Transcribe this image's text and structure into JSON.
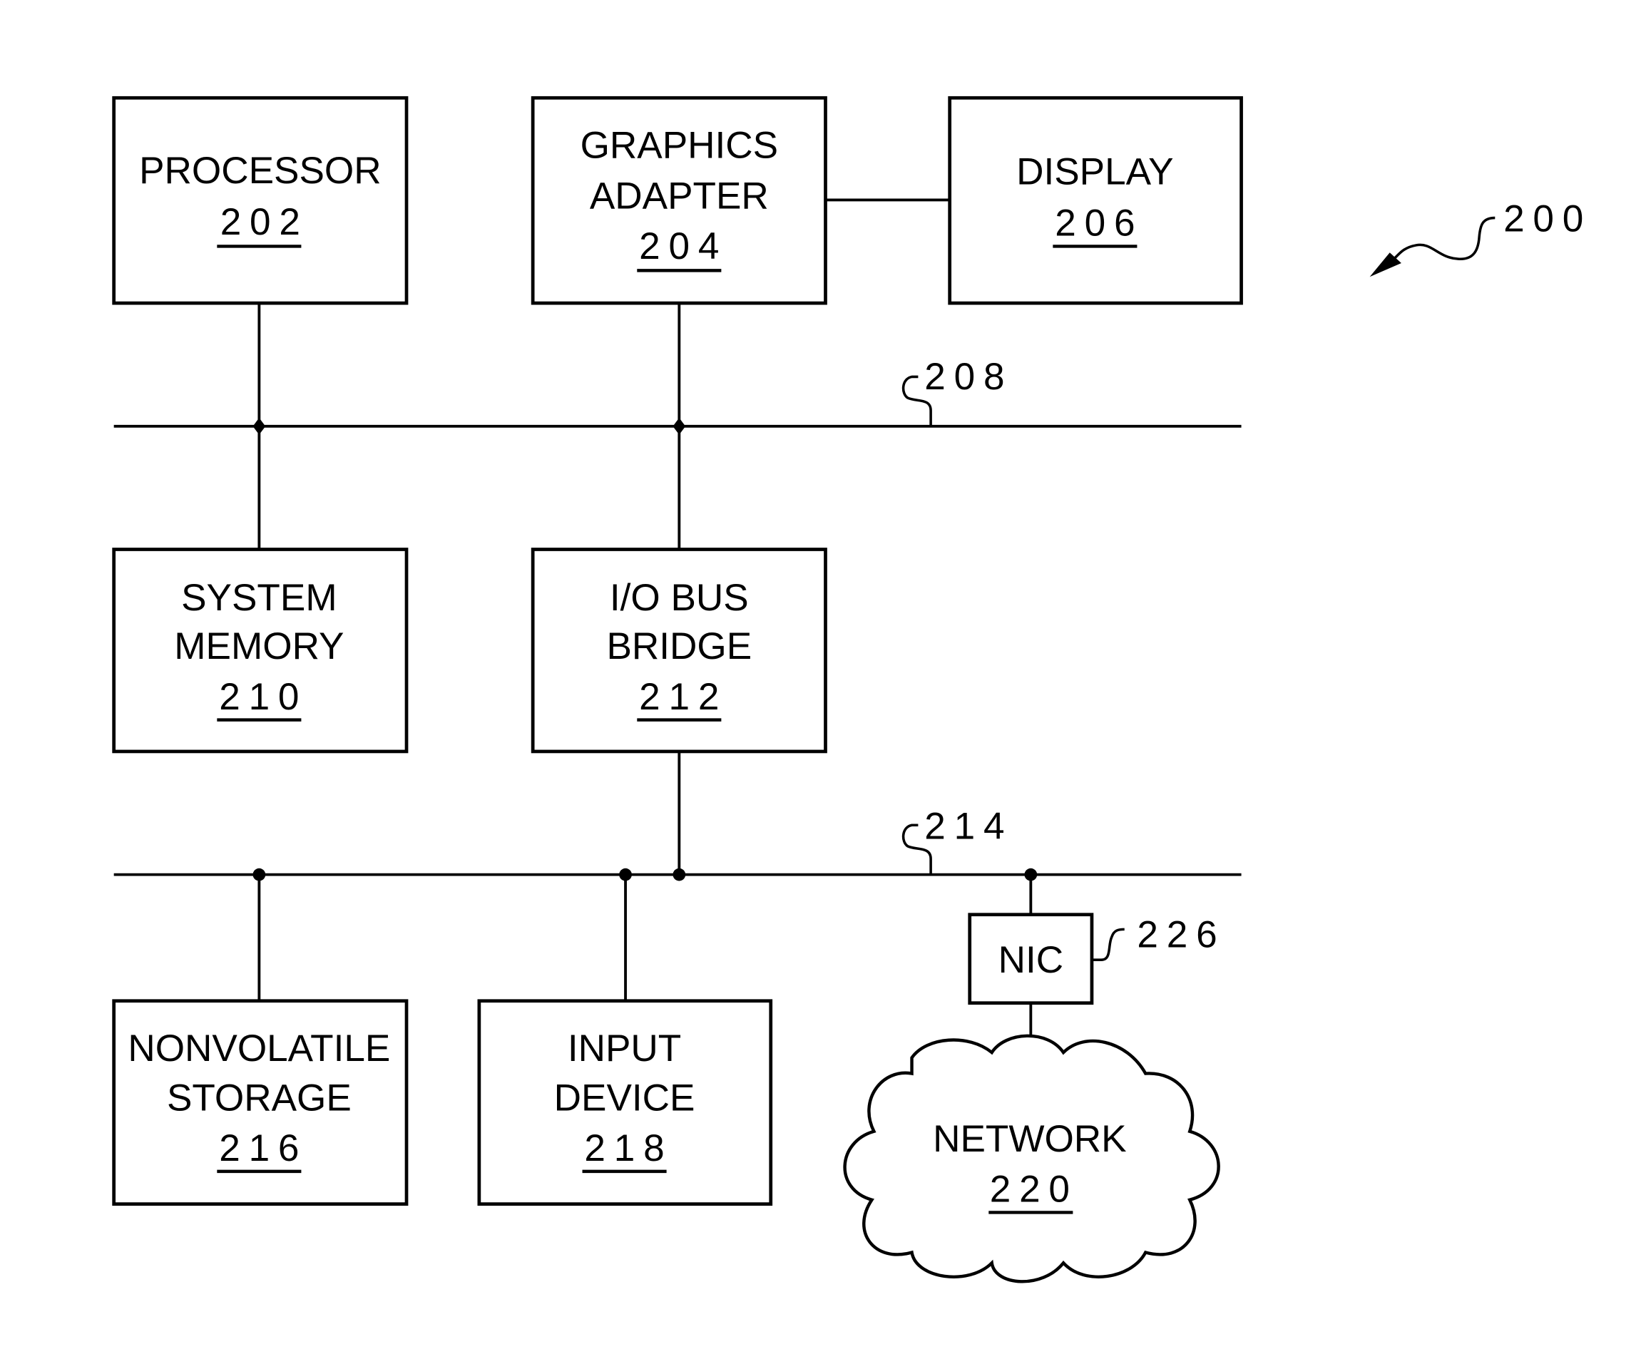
{
  "figure_ref": "200",
  "components": {
    "processor": {
      "lines": [
        "PROCESSOR"
      ],
      "ref": "202"
    },
    "graphics_adapter": {
      "lines": [
        "GRAPHICS",
        "ADAPTER"
      ],
      "ref": "204"
    },
    "display": {
      "lines": [
        "DISPLAY"
      ],
      "ref": "206"
    },
    "system_memory": {
      "lines": [
        "SYSTEM",
        "MEMORY"
      ],
      "ref": "210"
    },
    "io_bus_bridge": {
      "lines": [
        "I/O BUS",
        "BRIDGE"
      ],
      "ref": "212"
    },
    "nonvolatile_storage": {
      "lines": [
        "NONVOLATILE",
        "STORAGE"
      ],
      "ref": "216"
    },
    "input_device": {
      "lines": [
        "INPUT",
        "DEVICE"
      ],
      "ref": "218"
    },
    "nic": {
      "lines": [
        "NIC"
      ],
      "ref": "226"
    },
    "network": {
      "lines": [
        "NETWORK"
      ],
      "ref": "220"
    }
  },
  "buses": {
    "system_bus": {
      "ref": "208"
    },
    "io_bus": {
      "ref": "214"
    }
  }
}
